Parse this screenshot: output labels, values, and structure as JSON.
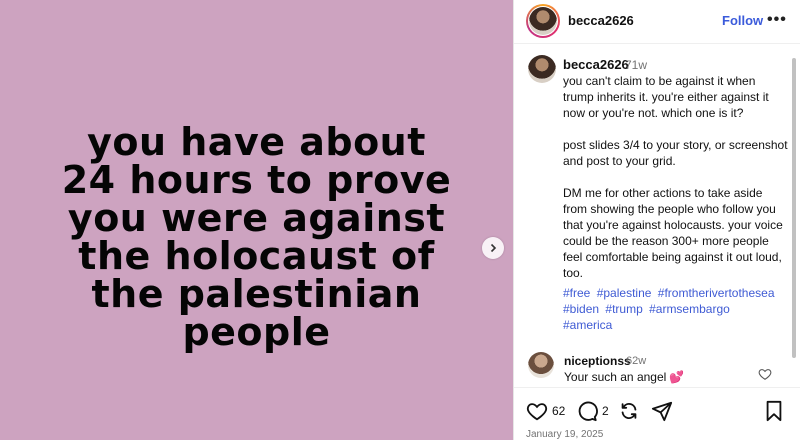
{
  "post": {
    "headline": "you have about\n24 hours to prove\nyou were against\nthe holocaust of\nthe palestinian\npeople",
    "background_color": "#cda3c0"
  },
  "header": {
    "username": "becca2626",
    "follow_label": "Follow",
    "more_icon": "more-dots-icon"
  },
  "caption": {
    "username": "becca2626",
    "time": "71w",
    "text": "you can't claim to be against it when trump inherits it. you're either against it now or you're not. which one is it?\n\npost slides 3/4 to your story, or screenshot and post to your grid.\n\nDM me for other actions to take aside from showing the people who follow you that you're against holocausts. your voice could be the reason 300+ more people feel comfortable being against it out loud, too.",
    "hashtags": [
      "#free",
      "#palestine",
      "#fromtherivertothesea",
      "#biden",
      "#trump",
      "#armsembargo",
      "#america"
    ]
  },
  "comment": {
    "username": "niceptionss",
    "time": "62w",
    "text": "Your such an angel",
    "emoji": "💕"
  },
  "actions": {
    "like_count": "62",
    "comment_count": "2",
    "date": "January 19, 2025"
  },
  "colors": {
    "link": "#3b5bdb",
    "hashtag": "#3f5bd4"
  }
}
